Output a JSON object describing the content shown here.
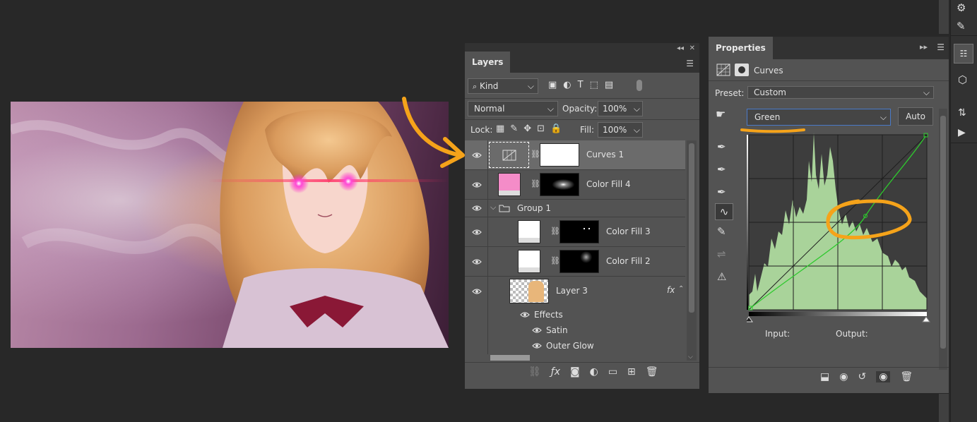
{
  "layers_panel": {
    "tab_title": "Layers",
    "filter_kind": "Kind",
    "blend_mode": "Normal",
    "opacity_label": "Opacity:",
    "opacity_value": "100%",
    "lock_label": "Lock:",
    "fill_label": "Fill:",
    "fill_value": "100%",
    "layers": [
      {
        "name": "Curves 1"
      },
      {
        "name": "Color Fill 4"
      },
      {
        "name": "Group 1"
      },
      {
        "name": "Color Fill 3"
      },
      {
        "name": "Color Fill 2"
      },
      {
        "name": "Layer 3"
      }
    ],
    "effects_label": "Effects",
    "effect_items": [
      "Satin",
      "Outer Glow"
    ],
    "fx_badge": "fx"
  },
  "properties_panel": {
    "tab_title": "Properties",
    "adjustment_name": "Curves",
    "preset_label": "Preset:",
    "preset_value": "Custom",
    "channel_value": "Green",
    "auto_button": "Auto",
    "input_label": "Input:",
    "output_label": "Output:"
  },
  "colors": {
    "annotation": "#f5a31a",
    "fill4_swatch": "#f48cc8",
    "histogram": "#a9d39a",
    "curve": "#2ec92e"
  }
}
